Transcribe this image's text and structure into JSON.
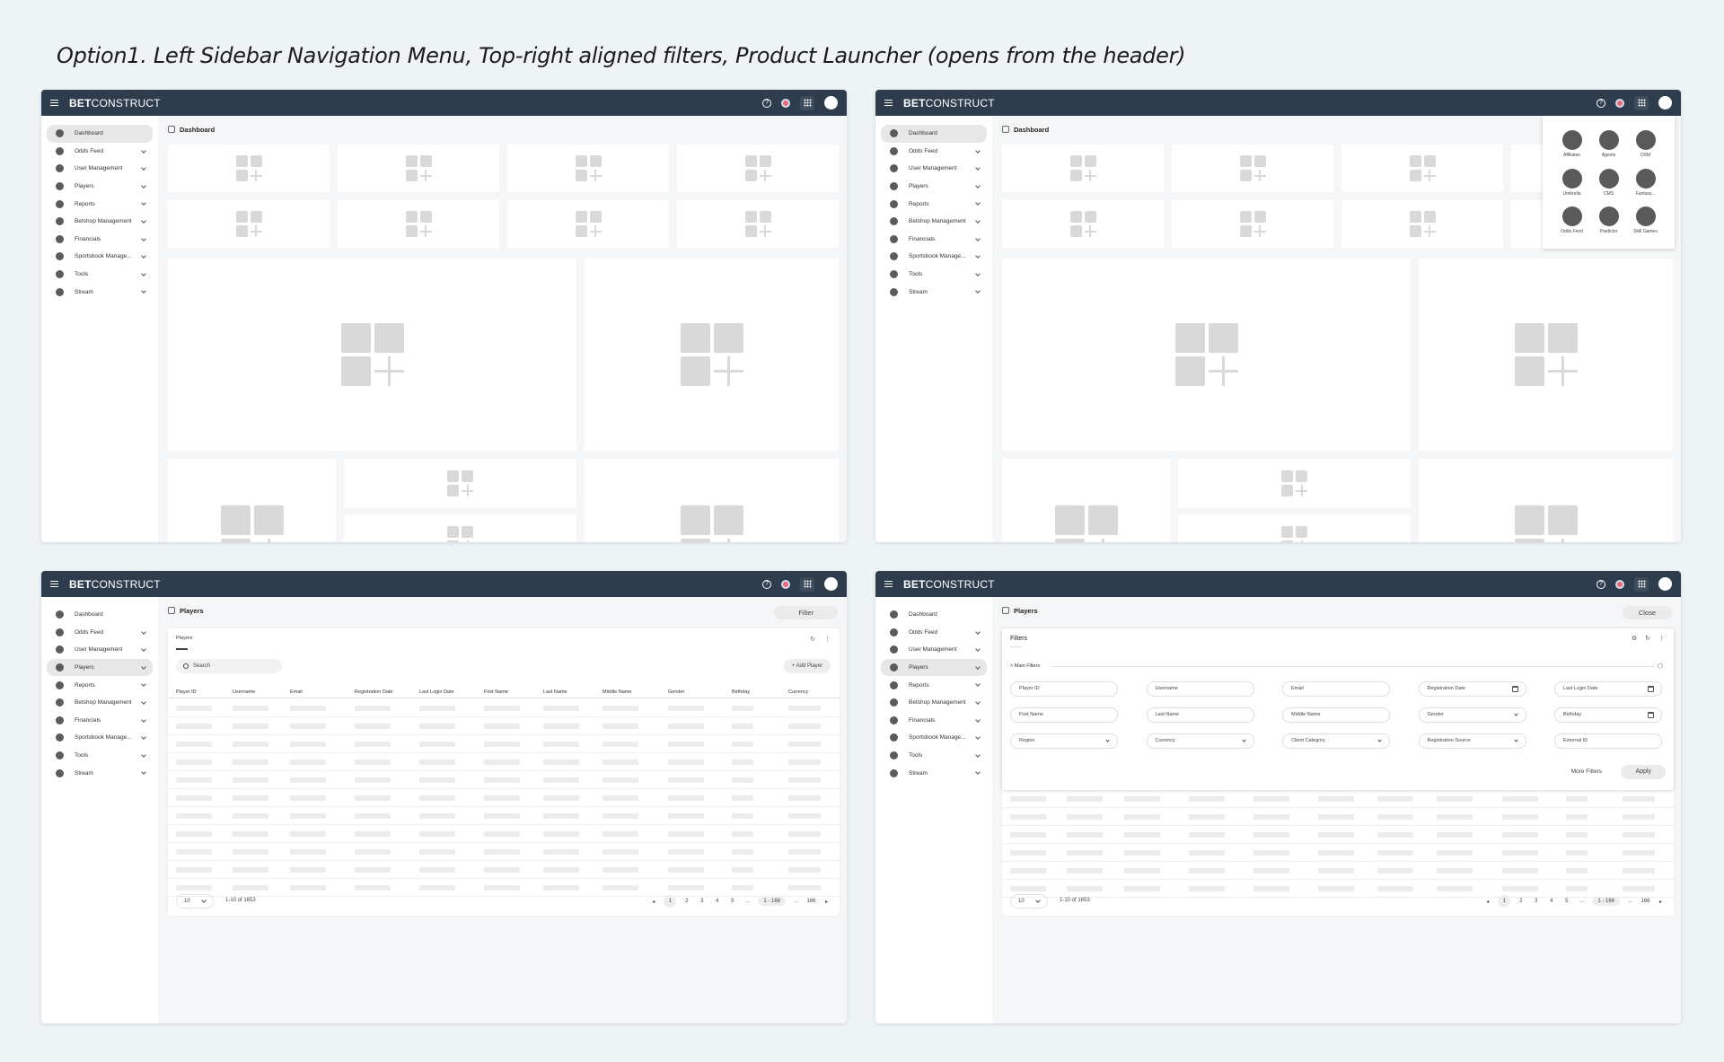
{
  "title": "Option1. Left Sidebar Navigation Menu, Top-right aligned filters, Product Launcher (opens from the header)",
  "logo": {
    "bold": "BET",
    "light": "CONSTRUCT"
  },
  "header_icons": {
    "help": "?"
  },
  "sidebar": {
    "items": [
      {
        "label": "Dashboard",
        "has_chevron": false
      },
      {
        "label": "Odds Feed",
        "has_chevron": true
      },
      {
        "label": "User Management",
        "has_chevron": true
      },
      {
        "label": "Players",
        "has_chevron": true
      },
      {
        "label": "Reports",
        "has_chevron": true
      },
      {
        "label": "Betshop Management",
        "has_chevron": true
      },
      {
        "label": "Financials",
        "has_chevron": true
      },
      {
        "label": "Sportsbook Manage...",
        "has_chevron": true
      },
      {
        "label": "Tools",
        "has_chevron": true
      },
      {
        "label": "Stream",
        "has_chevron": true
      }
    ]
  },
  "dashboard": {
    "page_title": "Dashboard"
  },
  "launcher": {
    "apps": [
      "Affiliates",
      "Agents",
      "CRM",
      "Umbrella",
      "CMS",
      "Fantasy...",
      "Odds Feed",
      "Predictor",
      "Skill Games"
    ]
  },
  "players": {
    "page_title": "Players",
    "filter_label": "Filter",
    "close_label": "Close",
    "tab_label": "Players",
    "search_placeholder": "Search",
    "add_label": "+ Add Player",
    "columns": [
      "Player ID",
      "Username",
      "Email",
      "Registration Date",
      "Last Login Date",
      "First Name",
      "Last Name",
      "Middle Name",
      "Gender",
      "Birthday",
      "Currency"
    ],
    "page_size": "10",
    "range_label": "1-10  of  1653",
    "pages": [
      "1",
      "2",
      "3",
      "4",
      "5",
      "...",
      "1 - 166",
      "...",
      "166"
    ]
  },
  "filters": {
    "title": "Filters",
    "section": "Main Filters",
    "fields": [
      {
        "label": "Player ID",
        "kind": "text"
      },
      {
        "label": "Username",
        "kind": "text"
      },
      {
        "label": "Email",
        "kind": "text"
      },
      {
        "label": "Registration Date",
        "kind": "date"
      },
      {
        "label": "Last Login Date",
        "kind": "date"
      },
      {
        "label": "First Name",
        "kind": "text"
      },
      {
        "label": "Last Name",
        "kind": "text"
      },
      {
        "label": "Middle Name",
        "kind": "text"
      },
      {
        "label": "Gender",
        "kind": "select"
      },
      {
        "label": "Birthday",
        "kind": "date"
      },
      {
        "label": "Region",
        "kind": "select"
      },
      {
        "label": "Currency",
        "kind": "select"
      },
      {
        "label": "Client Category",
        "kind": "select"
      },
      {
        "label": "Registration Source",
        "kind": "select"
      },
      {
        "label": "External ID",
        "kind": "text"
      }
    ],
    "more_label": "More Filters",
    "apply_label": "Apply"
  }
}
